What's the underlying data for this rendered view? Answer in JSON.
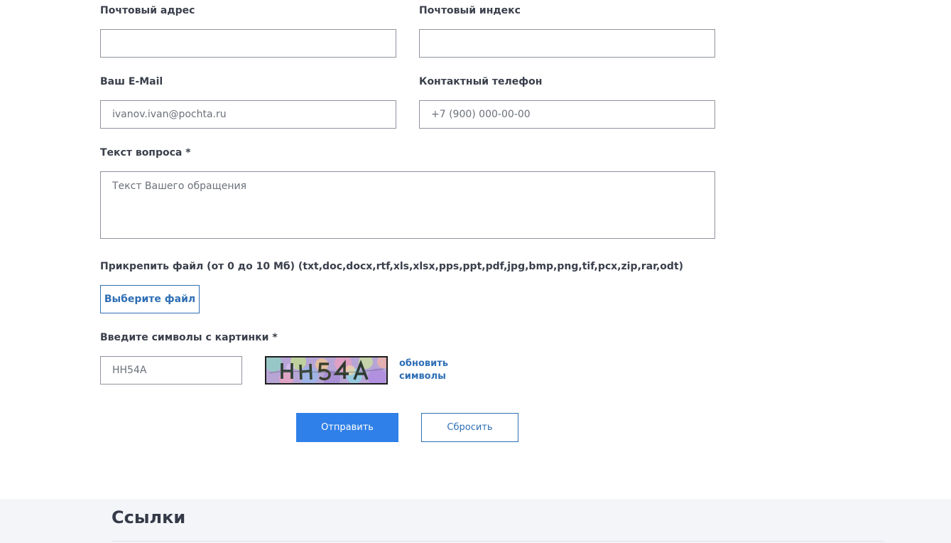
{
  "form": {
    "postal_address": {
      "label": "Почтовый адрес",
      "value": "",
      "placeholder": ""
    },
    "postal_code": {
      "label": "Почтовый индекс",
      "value": "",
      "placeholder": ""
    },
    "email": {
      "label": "Ваш E-Mail",
      "value": "",
      "placeholder": "ivanov.ivan@pochta.ru"
    },
    "phone": {
      "label": "Контактный телефон",
      "value": "",
      "placeholder": "+7 (900) 000-00-00"
    },
    "question": {
      "label": "Текст вопроса *",
      "value": "",
      "placeholder": "Текст Вашего обращения"
    },
    "attachment": {
      "label": "Прикрепить файл (от 0 до 10 Мб) (txt,doc,docx,rtf,xls,xlsx,pps,ppt,pdf,jpg,bmp,png,tif,pcx,zip,rar,odt)",
      "button_label": "Выберите файл"
    },
    "captcha": {
      "label": "Введите символы с картинки *",
      "value": "",
      "placeholder": "HH54A",
      "refresh_label": "обновить символы"
    },
    "submit_label": "Отправить",
    "reset_label": "Сбросить"
  },
  "footer": {
    "title": "Ссылки"
  },
  "colors": {
    "accent": "#2f80e8",
    "link": "#2f6fb5",
    "footer_bg": "#f3f5f9"
  },
  "icons": {
    "captcha_image": "captcha-image"
  }
}
